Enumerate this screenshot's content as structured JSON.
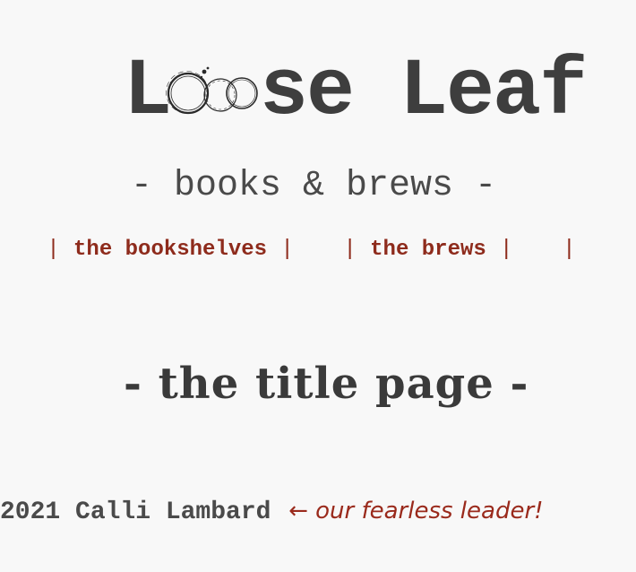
{
  "header": {
    "logo_start": "L",
    "logo_end": "se Leaf",
    "tagline": "- books & brews -"
  },
  "nav": {
    "items": [
      {
        "label": "the bookshelves"
      },
      {
        "label": "the brews"
      }
    ],
    "separator": "|"
  },
  "main": {
    "page_title": "- the title page -"
  },
  "footer": {
    "credit": "2021 Calli Lambard",
    "note": "← our fearless leader!"
  },
  "colors": {
    "background": "#f8f8f8",
    "text": "#444444",
    "accent": "#8e2b1c"
  }
}
